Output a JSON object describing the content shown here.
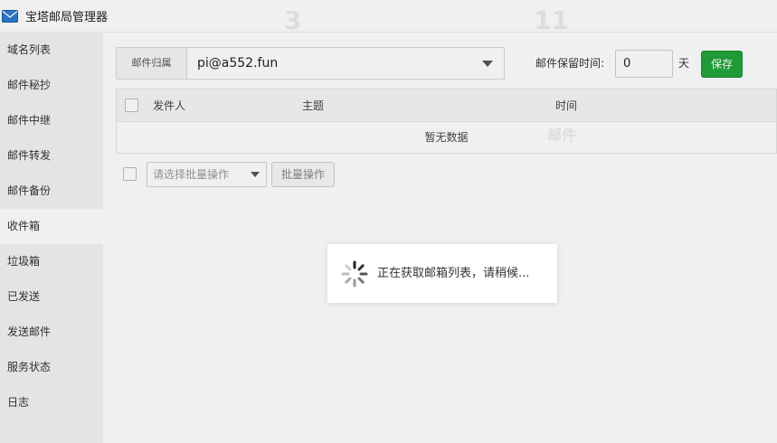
{
  "window": {
    "title": "宝塔邮局管理器",
    "icon": "mail-icon"
  },
  "sidebar": {
    "items": [
      {
        "label": "域名列表"
      },
      {
        "label": "邮件秘抄"
      },
      {
        "label": "邮件中继"
      },
      {
        "label": "邮件转发"
      },
      {
        "label": "邮件备份"
      },
      {
        "label": "收件箱",
        "active": true
      },
      {
        "label": "垃圾箱"
      },
      {
        "label": "已发送"
      },
      {
        "label": "发送邮件"
      },
      {
        "label": "服务状态"
      },
      {
        "label": "日志"
      }
    ]
  },
  "filter": {
    "owner_label": "邮件归属",
    "owner_value": "pi@a552.fun",
    "retain_label": "邮件保留时间:",
    "retain_value": "0",
    "retain_unit": "天",
    "save_label": "保存"
  },
  "table": {
    "columns": [
      "发件人",
      "主题",
      "时间"
    ],
    "empty_text": "暂无数据"
  },
  "batch": {
    "select_placeholder": "请选择批量操作",
    "button_label": "批量操作"
  },
  "background_ghost": {
    "numbers": [
      "3",
      "11"
    ],
    "labels": [
      "邮件"
    ]
  },
  "loading": {
    "text": "正在获取邮箱列表，请稍候..."
  },
  "colors": {
    "accent": "#20a53a",
    "sidebar_bg": "#f3f3f3",
    "mask": "rgba(0,0,0,0.06)"
  }
}
